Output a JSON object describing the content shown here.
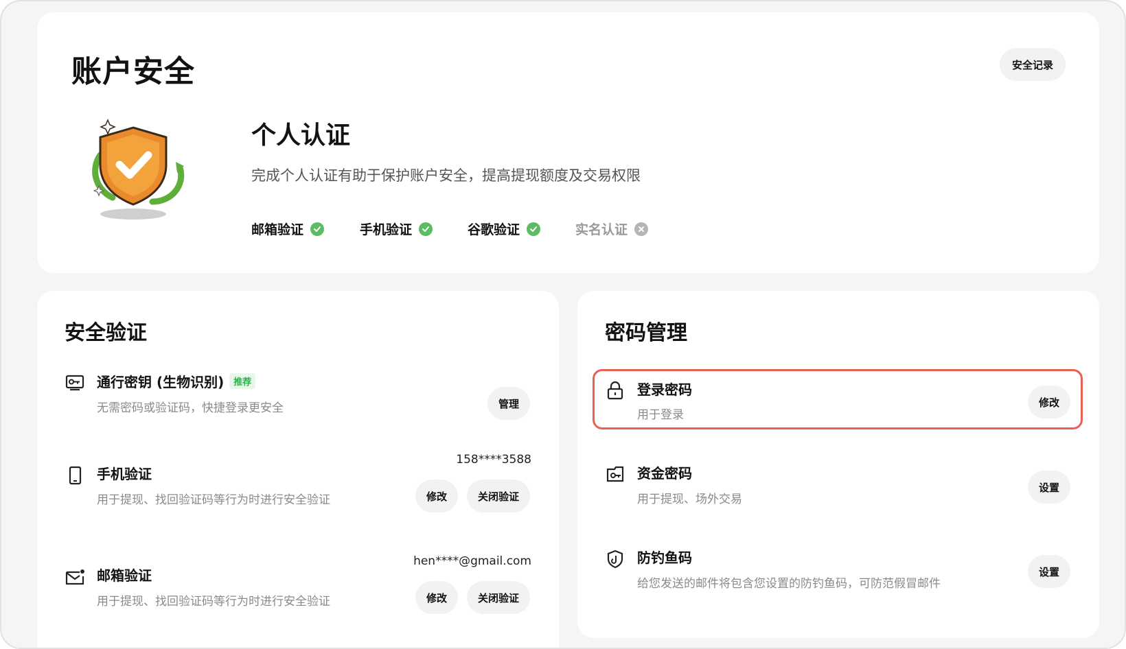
{
  "header": {
    "title": "账户安全",
    "records_label": "安全记录"
  },
  "personal_auth": {
    "title": "个人认证",
    "description": "完成个人认证有助于保护账户安全，提高提现额度及交易权限",
    "items": [
      {
        "label": "邮箱验证",
        "status": "verified"
      },
      {
        "label": "手机验证",
        "status": "verified"
      },
      {
        "label": "谷歌验证",
        "status": "verified"
      },
      {
        "label": "实名认证",
        "status": "unverified"
      }
    ]
  },
  "security_verification": {
    "title": "安全验证",
    "passkey": {
      "title": "通行密钥 (生物识别)",
      "badge": "推荐",
      "description": "无需密码或验证码，快捷登录更安全",
      "manage_label": "管理"
    },
    "phone": {
      "title": "手机验证",
      "description": "用于提现、找回验证码等行为时进行安全验证",
      "value": "158****3588",
      "edit_label": "修改",
      "disable_label": "关闭验证"
    },
    "email": {
      "title": "邮箱验证",
      "description": "用于提现、找回验证码等行为时进行安全验证",
      "value": "hen****@gmail.com",
      "edit_label": "修改",
      "disable_label": "关闭验证"
    }
  },
  "password_management": {
    "title": "密码管理",
    "login_password": {
      "title": "登录密码",
      "description": "用于登录",
      "action_label": "修改"
    },
    "fund_password": {
      "title": "资金密码",
      "description": "用于提现、场外交易",
      "action_label": "设置"
    },
    "anti_phishing": {
      "title": "防钓鱼码",
      "description": "给您发送的邮件将包含您设置的防钓鱼码，可防范假冒邮件",
      "action_label": "设置"
    }
  },
  "colors": {
    "verified": "#5dbb63",
    "unverified": "#b5b5b5",
    "highlight": "#e8604f",
    "badge_text": "#2bb24c"
  }
}
